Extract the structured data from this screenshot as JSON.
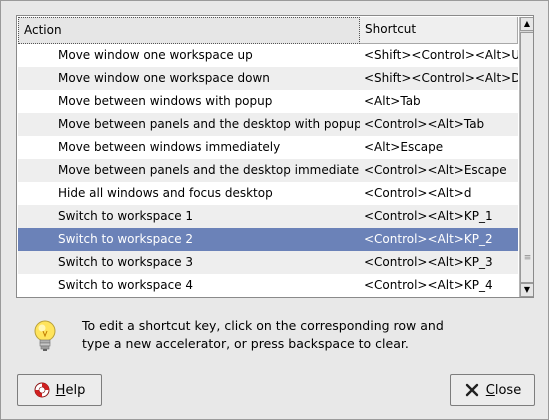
{
  "table": {
    "columns": [
      "Action",
      "Shortcut"
    ],
    "rows": [
      {
        "action": "Move window one workspace up",
        "shortcut": "<Shift><Control><Alt>Up"
      },
      {
        "action": "Move window one workspace down",
        "shortcut": "<Shift><Control><Alt>Down"
      },
      {
        "action": "Move between windows with popup",
        "shortcut": "<Alt>Tab"
      },
      {
        "action": "Move between panels and the desktop with popup",
        "shortcut": "<Control><Alt>Tab"
      },
      {
        "action": "Move between windows immediately",
        "shortcut": "<Alt>Escape"
      },
      {
        "action": "Move between panels and the desktop immediately",
        "shortcut": "<Control><Alt>Escape"
      },
      {
        "action": "Hide all windows and focus desktop",
        "shortcut": "<Control><Alt>d"
      },
      {
        "action": "Switch to workspace 1",
        "shortcut": "<Control><Alt>KP_1"
      },
      {
        "action": "Switch to workspace 2",
        "shortcut": "<Control><Alt>KP_2",
        "selected": true
      },
      {
        "action": "Switch to workspace 3",
        "shortcut": "<Control><Alt>KP_3"
      },
      {
        "action": "Switch to workspace 4",
        "shortcut": "<Control><Alt>KP_4"
      }
    ]
  },
  "hint": {
    "icon": "lightbulb-icon",
    "line1": "To edit a shortcut key, click on the corresponding row and",
    "line2": "type a new accelerator, or press backspace to clear."
  },
  "buttons": {
    "help": {
      "mnemonic": "H",
      "rest": "elp",
      "icon": "lifebuoy-icon"
    },
    "close": {
      "mnemonic": "C",
      "rest": "lose",
      "icon": "close-x-icon"
    }
  },
  "colors": {
    "selection": "#6b82b8",
    "window_bg": "#e8e8e8",
    "alt_row": "#eeeeee"
  }
}
